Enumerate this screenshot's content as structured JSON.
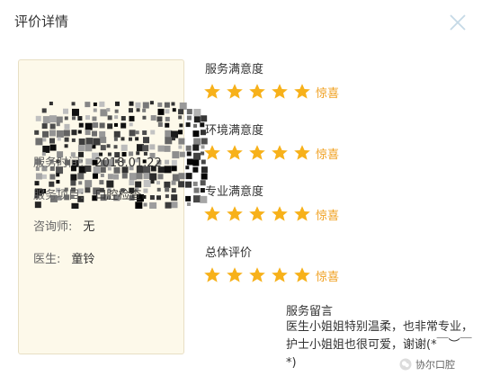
{
  "dialog": {
    "title": "评价详情"
  },
  "info": {
    "rows": [
      {
        "label": "服务时间:",
        "value": "2018.01.22"
      },
      {
        "label": "服务项目:",
        "value": "口腔检查"
      },
      {
        "label": "咨询师:",
        "value": "无"
      },
      {
        "label": "医生:",
        "value": "童铃"
      }
    ]
  },
  "ratings": [
    {
      "title": "服务满意度",
      "stars": 5,
      "label": "惊喜"
    },
    {
      "title": "环境满意度",
      "stars": 5,
      "label": "惊喜"
    },
    {
      "title": "专业满意度",
      "stars": 5,
      "label": "惊喜"
    },
    {
      "title": "总体评价",
      "stars": 5,
      "label": "惊喜"
    }
  ],
  "message": {
    "title": "服务留言",
    "text": "医生小姐姐特别温柔，也非常专业，护士小姐姐也很可爱，谢谢(*￣︶￣*)"
  },
  "watermark": {
    "text": "协尔口腔"
  },
  "colors": {
    "star": "#f7b11a",
    "rating_label": "#f0a020",
    "card_bg": "#fdf9ea",
    "close": "#c5d9e6"
  }
}
